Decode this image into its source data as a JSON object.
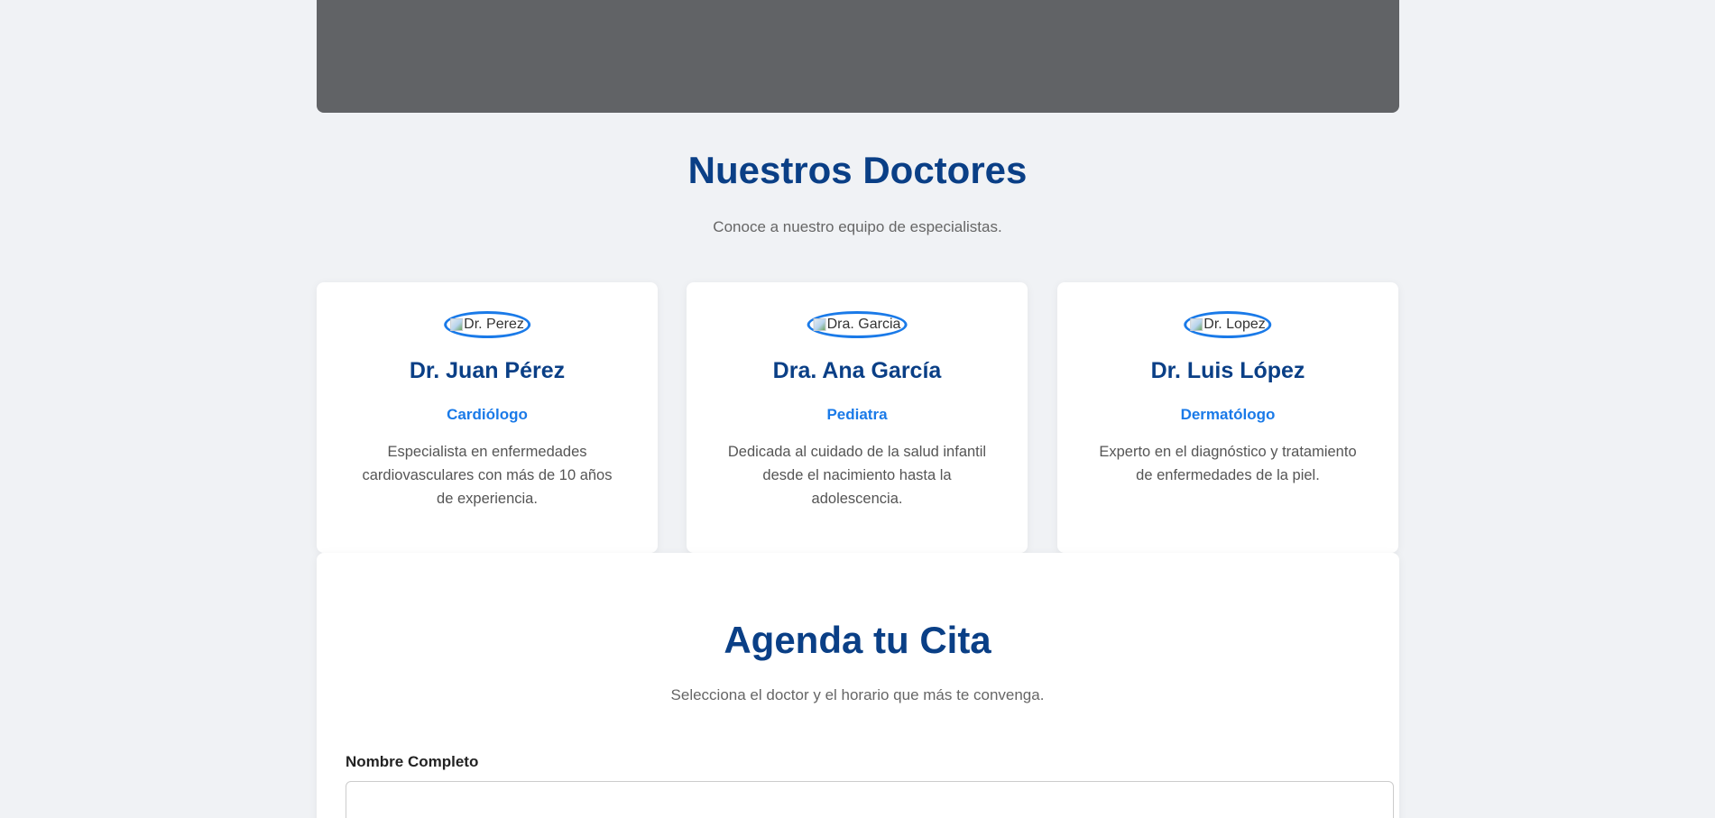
{
  "doctors_section": {
    "title": "Nuestros Doctores",
    "subtitle": "Conoce a nuestro equipo de especialistas.",
    "cards": [
      {
        "photo_alt": "Dr. Perez",
        "name": "Dr. Juan Pérez",
        "specialty": "Cardiólogo",
        "description": "Especialista en enfermedades cardiovasculares con más de 10 años de experiencia."
      },
      {
        "photo_alt": "Dra. Garcia",
        "name": "Dra. Ana García",
        "specialty": "Pediatra",
        "description": "Dedicada al cuidado de la salud infantil desde el nacimiento hasta la adolescencia."
      },
      {
        "photo_alt": "Dr. Lopez",
        "name": "Dr. Luis López",
        "specialty": "Dermatólogo",
        "description": "Experto en el diagnóstico y tratamiento de enfermedades de la piel."
      }
    ]
  },
  "booking_section": {
    "title": "Agenda tu Cita",
    "subtitle": "Selecciona el doctor y el horario que más te convenga.",
    "full_name_label": "Nombre Completo",
    "full_name_value": "",
    "full_name_placeholder": ""
  },
  "colors": {
    "heading": "#0a3f86",
    "accent": "#1a7ae8",
    "hero_bg": "#616366",
    "page_bg": "#f0f2f5"
  }
}
